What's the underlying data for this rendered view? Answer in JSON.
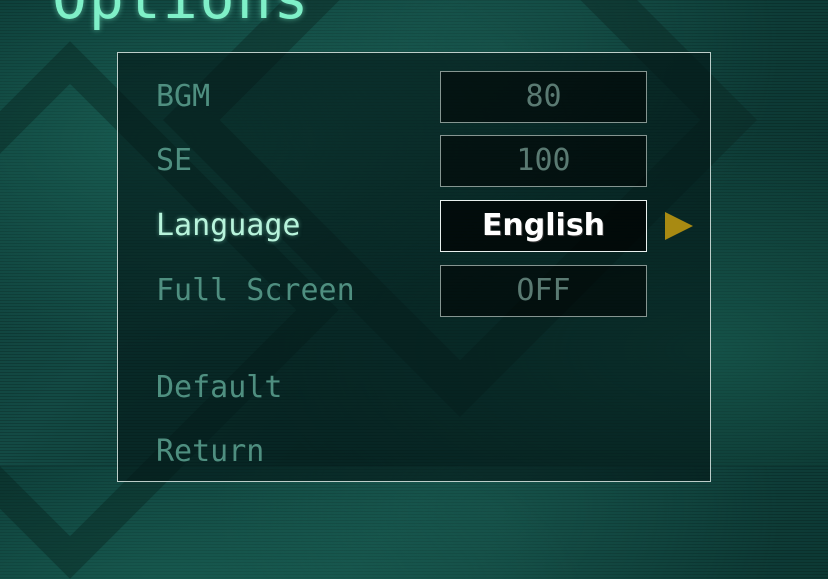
{
  "screen": {
    "title": "Options"
  },
  "settings": [
    {
      "label": "BGM",
      "value": "80"
    },
    {
      "label": "SE",
      "value": "100"
    },
    {
      "label": "Language",
      "value": "English"
    },
    {
      "label": "Full Screen",
      "value": "OFF"
    }
  ],
  "menu": {
    "default_label": "Default",
    "return_label": "Return"
  },
  "colors": {
    "title": "#7ff0c8",
    "active_text": "#b8f4dc",
    "inactive_text": "#4f8f80",
    "arrow": "#a88a12"
  },
  "icons": {
    "selection_arrow": "triangle-right-icon"
  }
}
